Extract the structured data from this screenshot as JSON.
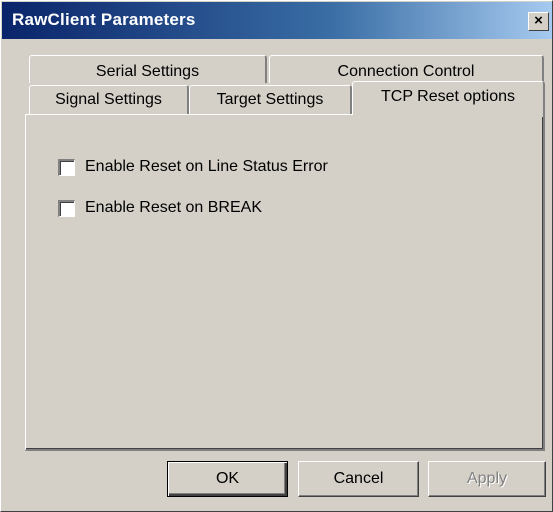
{
  "window": {
    "title": "RawClient Parameters",
    "close_label": "×"
  },
  "tabs": {
    "row1": [
      {
        "label": "Serial Settings"
      },
      {
        "label": "Connection Control"
      }
    ],
    "row2": [
      {
        "label": "Signal Settings"
      },
      {
        "label": "Target Settings"
      },
      {
        "label": "TCP Reset options",
        "active": true
      }
    ]
  },
  "options": [
    {
      "label": "Enable Reset on Line Status Error",
      "checked": false
    },
    {
      "label": "Enable Reset on BREAK",
      "checked": false
    }
  ],
  "buttons": {
    "ok": "OK",
    "cancel": "Cancel",
    "apply": "Apply",
    "apply_enabled": false
  },
  "colors": {
    "face": "#d4d0c8",
    "titlebar_start": "#0a246a",
    "titlebar_end": "#a6caf0"
  }
}
